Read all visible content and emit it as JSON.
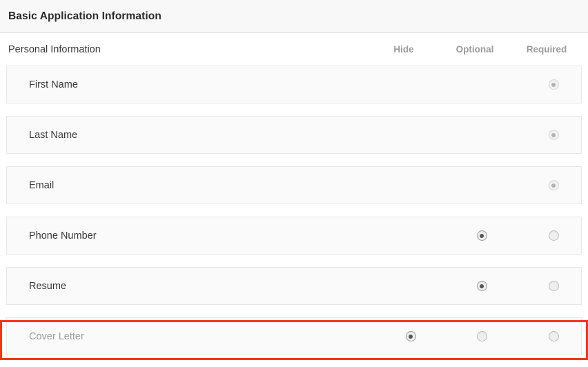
{
  "panel": {
    "title": "Basic Application Information"
  },
  "section": {
    "title": "Personal Information",
    "columns": [
      {
        "key": "hide",
        "label": "Hide"
      },
      {
        "key": "optional",
        "label": "Optional"
      },
      {
        "key": "required",
        "label": "Required"
      }
    ],
    "fields": [
      {
        "label": "First Name",
        "muted": false,
        "cells": [
          {
            "visible": false,
            "checked": false,
            "disabled": false
          },
          {
            "visible": false,
            "checked": false,
            "disabled": false
          },
          {
            "visible": true,
            "checked": true,
            "disabled": true
          }
        ]
      },
      {
        "label": "Last Name",
        "muted": false,
        "cells": [
          {
            "visible": false,
            "checked": false,
            "disabled": false
          },
          {
            "visible": false,
            "checked": false,
            "disabled": false
          },
          {
            "visible": true,
            "checked": true,
            "disabled": true
          }
        ]
      },
      {
        "label": "Email",
        "muted": false,
        "cells": [
          {
            "visible": false,
            "checked": false,
            "disabled": false
          },
          {
            "visible": false,
            "checked": false,
            "disabled": false
          },
          {
            "visible": true,
            "checked": true,
            "disabled": true
          }
        ]
      },
      {
        "label": "Phone Number",
        "muted": false,
        "cells": [
          {
            "visible": false,
            "checked": false,
            "disabled": false
          },
          {
            "visible": true,
            "checked": true,
            "disabled": false
          },
          {
            "visible": true,
            "checked": false,
            "disabled": false
          }
        ]
      },
      {
        "label": "Resume",
        "muted": false,
        "cells": [
          {
            "visible": false,
            "checked": false,
            "disabled": false
          },
          {
            "visible": true,
            "checked": true,
            "disabled": false
          },
          {
            "visible": true,
            "checked": false,
            "disabled": false
          }
        ]
      },
      {
        "label": "Cover Letter",
        "muted": true,
        "highlighted": true,
        "cells": [
          {
            "visible": true,
            "checked": true,
            "disabled": false
          },
          {
            "visible": true,
            "checked": false,
            "disabled": false
          },
          {
            "visible": true,
            "checked": false,
            "disabled": false
          }
        ]
      }
    ]
  },
  "annotation": {
    "highlight_color": "#f4371b",
    "target_row_label": "Cover Letter"
  }
}
